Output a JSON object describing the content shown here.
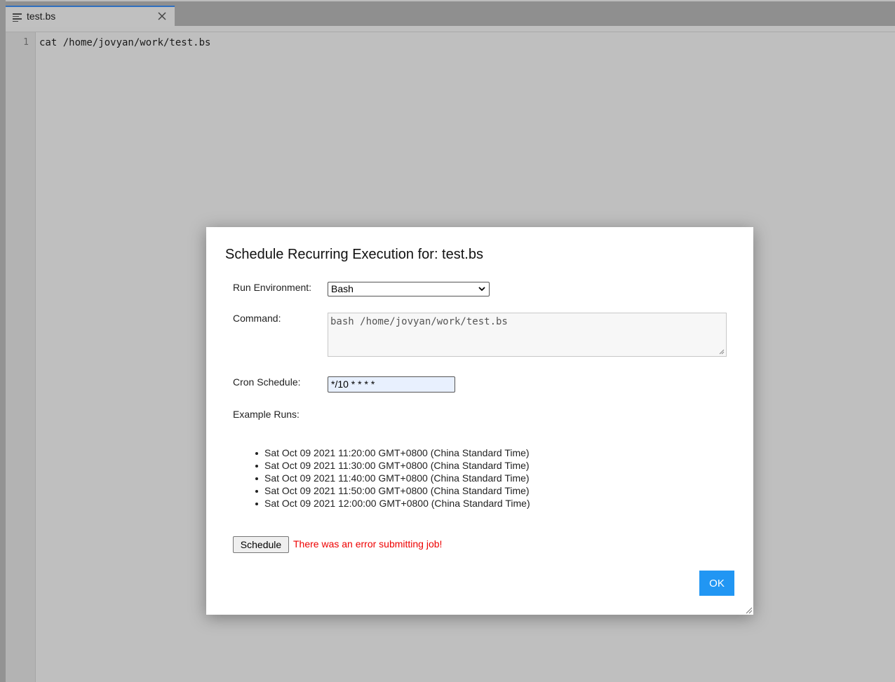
{
  "tab": {
    "title": "test.bs",
    "icon": "text-file-icon"
  },
  "editor": {
    "line_number": "1",
    "code": "cat /home/jovyan/work/test.bs"
  },
  "dialog": {
    "title": "Schedule Recurring Execution for: test.bs",
    "run_env_label": "Run Environment:",
    "run_env_value": "Bash",
    "command_label": "Command:",
    "command_value": "bash /home/jovyan/work/test.bs",
    "cron_label": "Cron Schedule:",
    "cron_value": "*/10 * * * *",
    "example_runs_label": "Example Runs:",
    "example_runs": [
      "Sat Oct 09 2021 11:20:00 GMT+0800 (China Standard Time)",
      "Sat Oct 09 2021 11:30:00 GMT+0800 (China Standard Time)",
      "Sat Oct 09 2021 11:40:00 GMT+0800 (China Standard Time)",
      "Sat Oct 09 2021 11:50:00 GMT+0800 (China Standard Time)",
      "Sat Oct 09 2021 12:00:00 GMT+0800 (China Standard Time)"
    ],
    "schedule_label": "Schedule",
    "error_message": "There was an error submitting job!",
    "ok_label": "OK"
  },
  "colors": {
    "accent": "#2196f3",
    "error": "#ee0000",
    "tab_active_border": "#2f6fbf"
  }
}
